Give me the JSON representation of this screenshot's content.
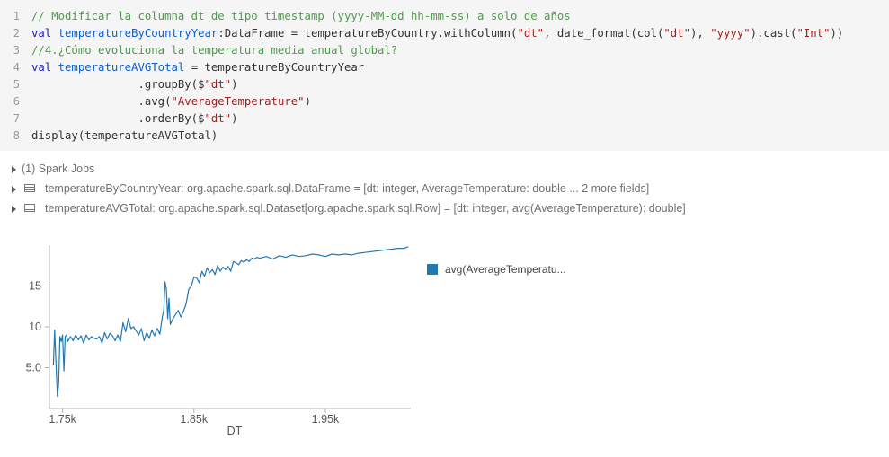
{
  "code": {
    "lines": [
      {
        "num": "1",
        "tokens": [
          {
            "t": "// Modificar la columna dt de tipo timestamp (yyyy-MM-dd hh-mm-ss) a solo de años",
            "c": "cm"
          }
        ]
      },
      {
        "num": "2",
        "tokens": [
          {
            "t": "val ",
            "c": "kw"
          },
          {
            "t": "temperatureByCountryYear",
            "c": "vr"
          },
          {
            "t": ":DataFrame = temperatureByCountry.withColumn(",
            "c": ""
          },
          {
            "t": "\"dt\"",
            "c": "st"
          },
          {
            "t": ", date_format(col(",
            "c": ""
          },
          {
            "t": "\"dt\"",
            "c": "st"
          },
          {
            "t": "), ",
            "c": ""
          },
          {
            "t": "\"yyyy\"",
            "c": "st"
          },
          {
            "t": ").cast(",
            "c": ""
          },
          {
            "t": "\"Int\"",
            "c": "st"
          },
          {
            "t": "))",
            "c": ""
          }
        ]
      },
      {
        "num": "3",
        "tokens": [
          {
            "t": "//4.¿Cómo evoluciona la temperatura media anual global?",
            "c": "cm"
          }
        ]
      },
      {
        "num": "4",
        "tokens": [
          {
            "t": "val ",
            "c": "kw"
          },
          {
            "t": "temperatureAVGTotal",
            "c": "vr"
          },
          {
            "t": " = temperatureByCountryYear",
            "c": ""
          }
        ]
      },
      {
        "num": "5",
        "tokens": [
          {
            "t": "                .groupBy($",
            "c": ""
          },
          {
            "t": "\"dt\"",
            "c": "st"
          },
          {
            "t": ")",
            "c": ""
          }
        ]
      },
      {
        "num": "6",
        "tokens": [
          {
            "t": "                .avg(",
            "c": ""
          },
          {
            "t": "\"AverageTemperature\"",
            "c": "st"
          },
          {
            "t": ")",
            "c": ""
          }
        ]
      },
      {
        "num": "7",
        "tokens": [
          {
            "t": "                .orderBy($",
            "c": ""
          },
          {
            "t": "\"dt\"",
            "c": "st"
          },
          {
            "t": ")",
            "c": ""
          }
        ]
      },
      {
        "num": "8",
        "tokens": [
          {
            "t": "display(temperatureAVGTotal)",
            "c": ""
          }
        ]
      }
    ]
  },
  "outputs": {
    "spark_jobs": "(1) Spark Jobs",
    "df1": "temperatureByCountryYear:  org.apache.spark.sql.DataFrame = [dt: integer, AverageTemperature: double ... 2 more fields]",
    "df2": "temperatureAVGTotal:  org.apache.spark.sql.Dataset[org.apache.spark.sql.Row] = [dt: integer, avg(AverageTemperature): double]"
  },
  "colors": {
    "series": "#1f77b4",
    "axis": "#b0b0b0",
    "tick_text": "#555555"
  },
  "chart_data": {
    "type": "line",
    "xlabel": "DT",
    "ylabel": "",
    "xlim": [
      1740,
      2015
    ],
    "ylim": [
      0,
      20
    ],
    "x_ticks": [
      {
        "v": 1750,
        "label": "1.75k"
      },
      {
        "v": 1850,
        "label": "1.85k"
      },
      {
        "v": 1950,
        "label": "1.95k"
      }
    ],
    "y_ticks": [
      {
        "v": 5,
        "label": "5.0"
      },
      {
        "v": 10,
        "label": "10"
      },
      {
        "v": 15,
        "label": "15"
      }
    ],
    "legend": "avg(AverageTemperatu...",
    "series": [
      {
        "name": "avg(AverageTemperatu...",
        "x": [
          1743,
          1744,
          1745,
          1746,
          1747,
          1748,
          1749,
          1750,
          1751,
          1752,
          1753,
          1754,
          1756,
          1758,
          1760,
          1762,
          1764,
          1766,
          1768,
          1770,
          1772,
          1774,
          1776,
          1778,
          1780,
          1782,
          1784,
          1786,
          1788,
          1790,
          1792,
          1794,
          1796,
          1798,
          1800,
          1802,
          1804,
          1806,
          1808,
          1810,
          1812,
          1814,
          1816,
          1818,
          1820,
          1822,
          1824,
          1826,
          1827,
          1828,
          1829,
          1830,
          1831,
          1832,
          1834,
          1836,
          1838,
          1840,
          1842,
          1844,
          1846,
          1848,
          1850,
          1852,
          1854,
          1856,
          1858,
          1860,
          1862,
          1864,
          1866,
          1868,
          1870,
          1872,
          1874,
          1876,
          1878,
          1880,
          1882,
          1884,
          1886,
          1888,
          1890,
          1892,
          1894,
          1896,
          1898,
          1900,
          1905,
          1910,
          1915,
          1920,
          1925,
          1930,
          1935,
          1940,
          1945,
          1950,
          1955,
          1960,
          1965,
          1970,
          1975,
          1980,
          1985,
          1990,
          1995,
          2000,
          2005,
          2010,
          2013
        ],
        "y": [
          5.3,
          9.6,
          5.5,
          1.5,
          3.0,
          8.8,
          8.2,
          9.0,
          4.6,
          8.8,
          9.0,
          8.2,
          8.8,
          8.3,
          9.0,
          8.4,
          8.9,
          8.0,
          9.0,
          8.4,
          8.8,
          8.6,
          8.5,
          8.8,
          8.0,
          9.3,
          8.5,
          9.2,
          8.9,
          8.3,
          9.0,
          8.2,
          10.5,
          9.4,
          11.0,
          9.8,
          10.0,
          9.5,
          9.0,
          9.8,
          8.3,
          9.3,
          8.6,
          9.6,
          8.9,
          9.8,
          9.1,
          11.3,
          12.0,
          15.5,
          14.6,
          11.0,
          13.5,
          10.3,
          11.0,
          11.5,
          12.0,
          11.2,
          11.9,
          12.8,
          14.6,
          15.0,
          16.1,
          16.0,
          15.4,
          16.8,
          16.2,
          17.2,
          16.6,
          17.0,
          16.4,
          17.5,
          16.8,
          17.3,
          17.0,
          17.4,
          16.8,
          18.0,
          17.8,
          17.6,
          18.1,
          17.9,
          18.2,
          18.0,
          18.4,
          18.3,
          18.5,
          18.4,
          18.6,
          18.3,
          18.7,
          18.5,
          18.8,
          18.6,
          18.7,
          18.9,
          18.8,
          18.6,
          18.9,
          18.8,
          18.9,
          18.8,
          19.0,
          19.1,
          19.2,
          19.3,
          19.4,
          19.5,
          19.6,
          19.6,
          19.8
        ]
      }
    ]
  }
}
